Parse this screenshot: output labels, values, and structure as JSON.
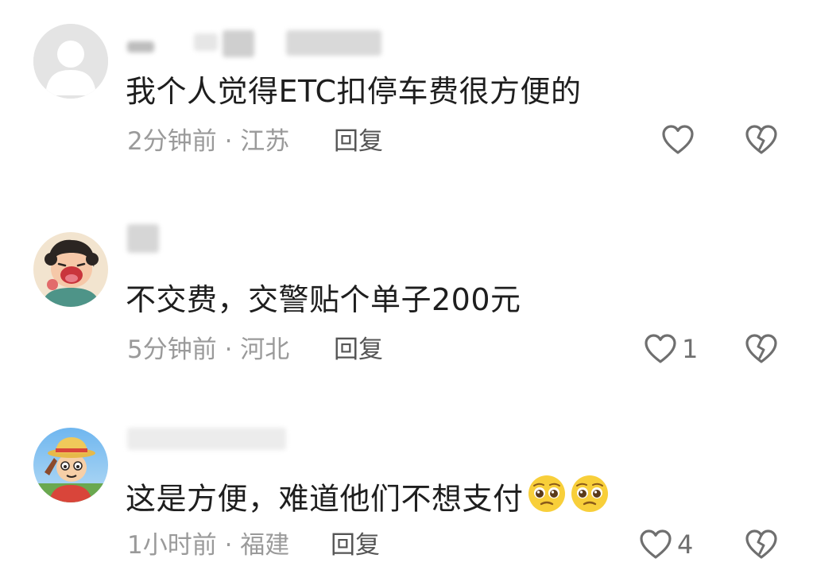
{
  "comments": [
    {
      "text": "我个人觉得ETC扣停车费很方便的",
      "time": "2分钟前",
      "location": "江苏",
      "meta_sep": " · ",
      "reply_label": "回复",
      "like_count": "",
      "avatar_icon": "default-user-avatar"
    },
    {
      "text": "不交费，交警贴个单子200元",
      "time": "5分钟前",
      "location": "河北",
      "meta_sep": " · ",
      "reply_label": "回复",
      "like_count": "1",
      "avatar_icon": "cartoon-crying-kid-avatar"
    },
    {
      "text": "这是方便，难道他们不想支付",
      "time": "1小时前",
      "location": "福建",
      "meta_sep": " · ",
      "reply_label": "回复",
      "like_count": "4",
      "avatar_icon": "cartoon-straw-hat-avatar",
      "emojis": [
        "pleading-face-emoji",
        "pleading-face-emoji"
      ]
    }
  ],
  "icons": {
    "like": "heart-outline-icon",
    "dislike": "broken-heart-icon"
  },
  "colors": {
    "text_primary": "#1e1e1e",
    "text_meta": "#9a9a9a",
    "icon_stroke": "#6f6f6f"
  }
}
